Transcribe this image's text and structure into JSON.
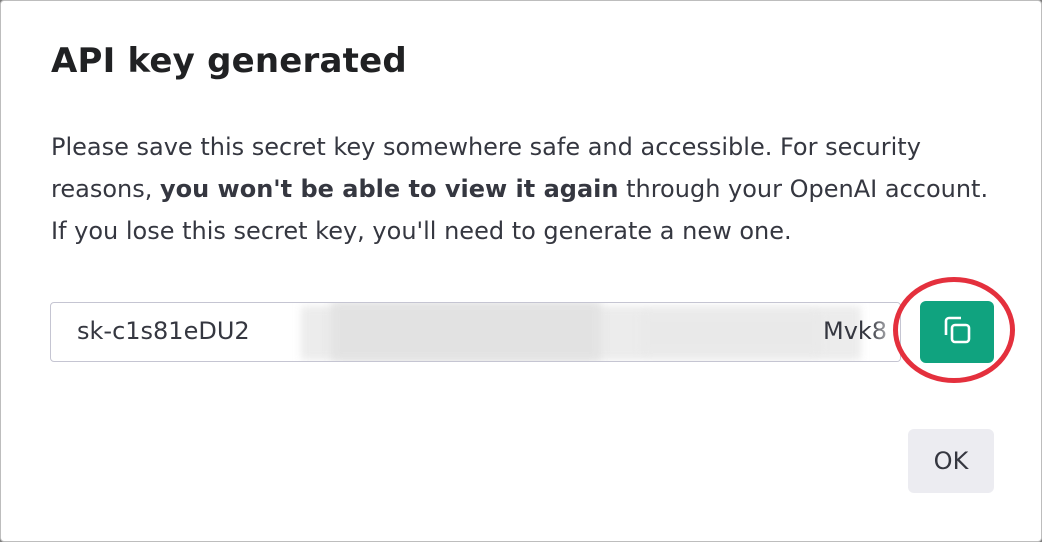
{
  "dialog": {
    "title": "API key generated",
    "message_part1": "Please save this secret key somewhere safe and accessible. For security reasons, ",
    "message_bold": "you won't be able to view it again",
    "message_part2": " through your OpenAI account. If you lose this secret key, you'll need to generate a new one.",
    "key_prefix": "sk-c1s81eDU2",
    "key_suffix": "Mvk8",
    "copy_icon": "copy-icon",
    "ok_label": "OK"
  },
  "colors": {
    "accent": "#10a37f",
    "highlight": "#e4303d",
    "ok_background": "#ececf1"
  }
}
